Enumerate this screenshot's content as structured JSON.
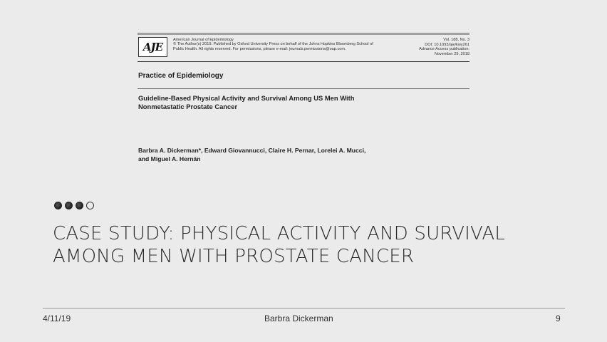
{
  "paper": {
    "logo_text": "AJE",
    "journal_lines": [
      "American Journal of Epidemiology",
      "© The Author(s) 2019. Published by Oxford University Press on behalf of the Johns Hopkins Bloomberg School of",
      "Public Health. All rights reserved. For permissions, please e-mail: journals.permissions@oup.com."
    ],
    "vol_lines": [
      "Vol. 188, No. 3",
      "DOI: 10.1093/aje/kwy261",
      "Advance Access publication:",
      "November 29, 2018"
    ],
    "section": "Practice of Epidemiology",
    "title_lines": [
      "Guideline-Based Physical Activity and Survival Among US Men With",
      "Nonmetastatic Prostate Cancer"
    ],
    "author_lines": [
      "Barbra A. Dickerman*, Edward Giovannucci, Claire H. Pernar, Lorelei A. Mucci,",
      "and Miguel A. Hernán"
    ]
  },
  "slide": {
    "title_lines": [
      "CASE STUDY: PHYSICAL ACTIVITY AND SURVIVAL",
      "AMONG MEN WITH PROSTATE CANCER"
    ]
  },
  "footer": {
    "date": "4/11/19",
    "author": "Barbra Dickerman",
    "page": "9"
  }
}
